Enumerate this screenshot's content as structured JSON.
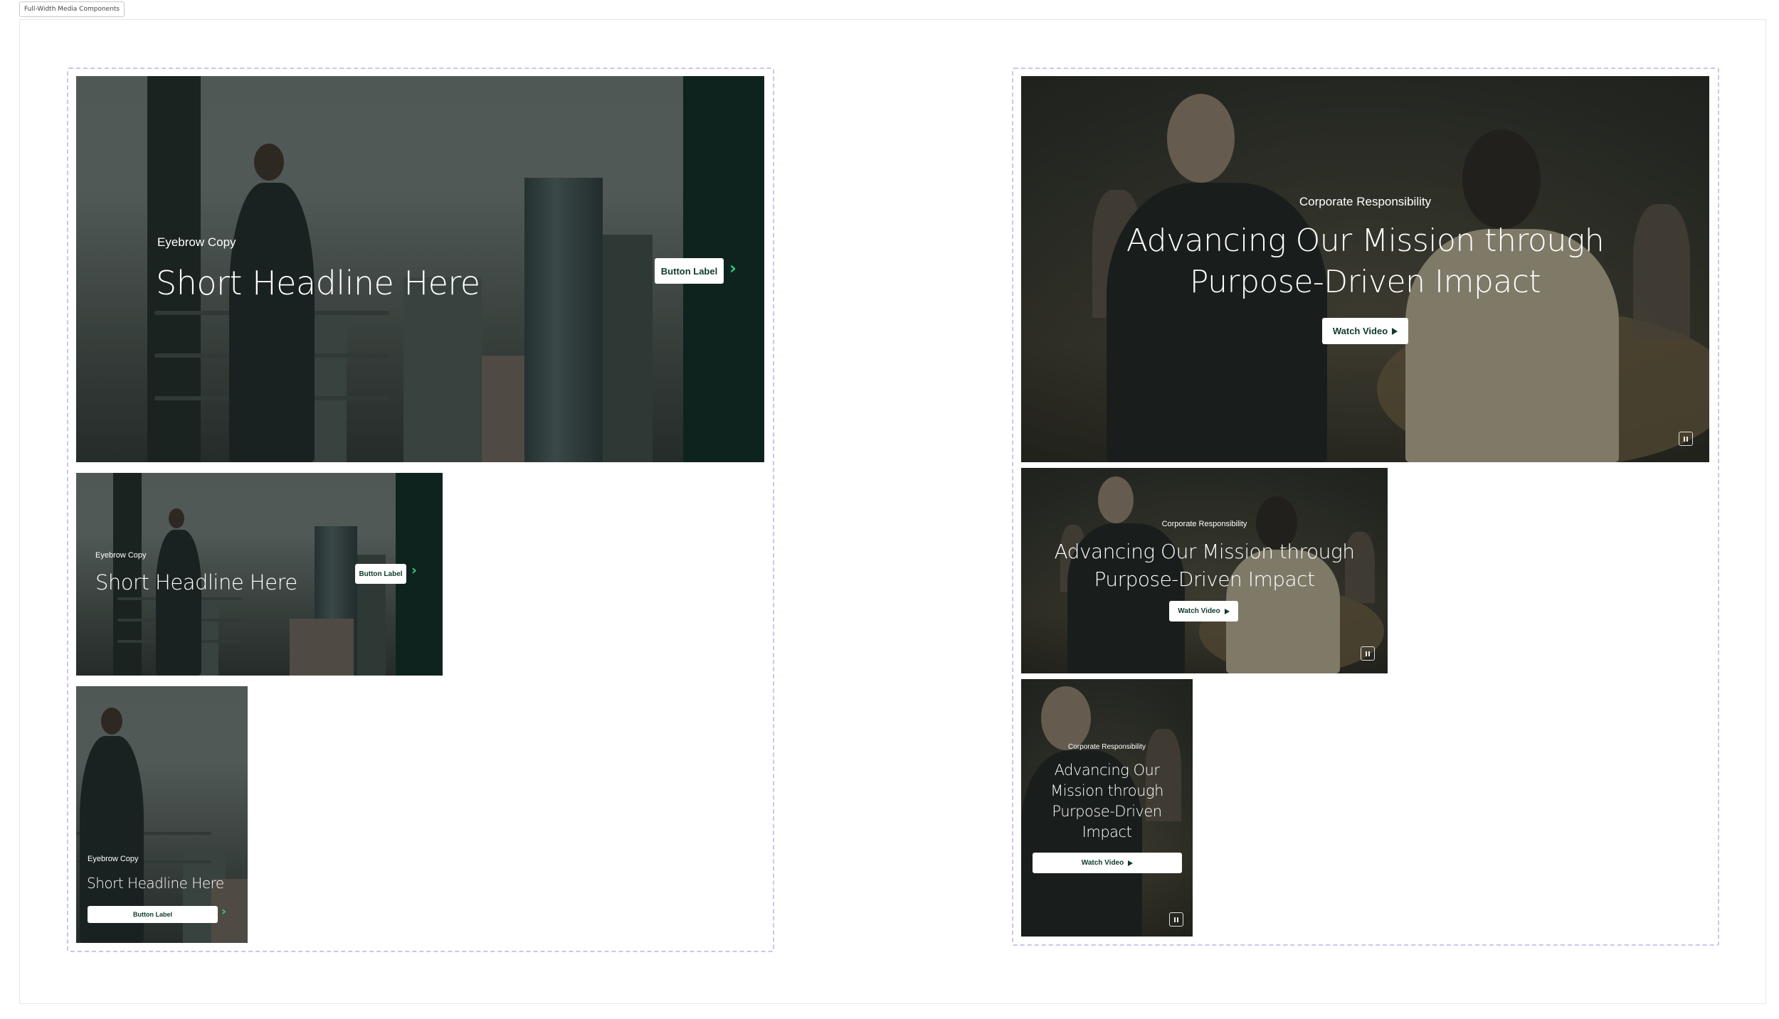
{
  "frame": {
    "label": "Full-Width Media Components"
  },
  "left_group": {
    "large": {
      "eyebrow": "Eyebrow Copy",
      "headline": "Short Headline Here",
      "button": "Button Label"
    },
    "medium": {
      "eyebrow": "Eyebrow Copy",
      "headline": "Short Headline Here",
      "button": "Button Label"
    },
    "small": {
      "eyebrow": "Eyebrow Copy",
      "headline": "Short Headline Here",
      "button": "Button Label"
    }
  },
  "right_group": {
    "large": {
      "eyebrow": "Corporate Responsibility",
      "headline_line1": "Advancing Our Mission through",
      "headline_line2": "Purpose-Driven Impact",
      "button": "Watch Video"
    },
    "medium": {
      "eyebrow": "Corporate Responsibility",
      "headline_line1": "Advancing Our Mission through",
      "headline_line2": "Purpose-Driven Impact",
      "button": "Watch Video"
    },
    "small": {
      "eyebrow": "Corporate Responsibility",
      "headline_lines": [
        "Advancing Our",
        "Mission through",
        "Purpose-Driven",
        "Impact"
      ],
      "button": "Watch Video"
    }
  },
  "colors": {
    "panel": "#0f231e",
    "accent": "#27d27c",
    "button_text": "#0f3a2c",
    "dashed_border": "#cfc3ee"
  },
  "icons": {
    "chevron": "chevron-right-icon",
    "play": "play-icon",
    "pause": "pause-icon"
  }
}
